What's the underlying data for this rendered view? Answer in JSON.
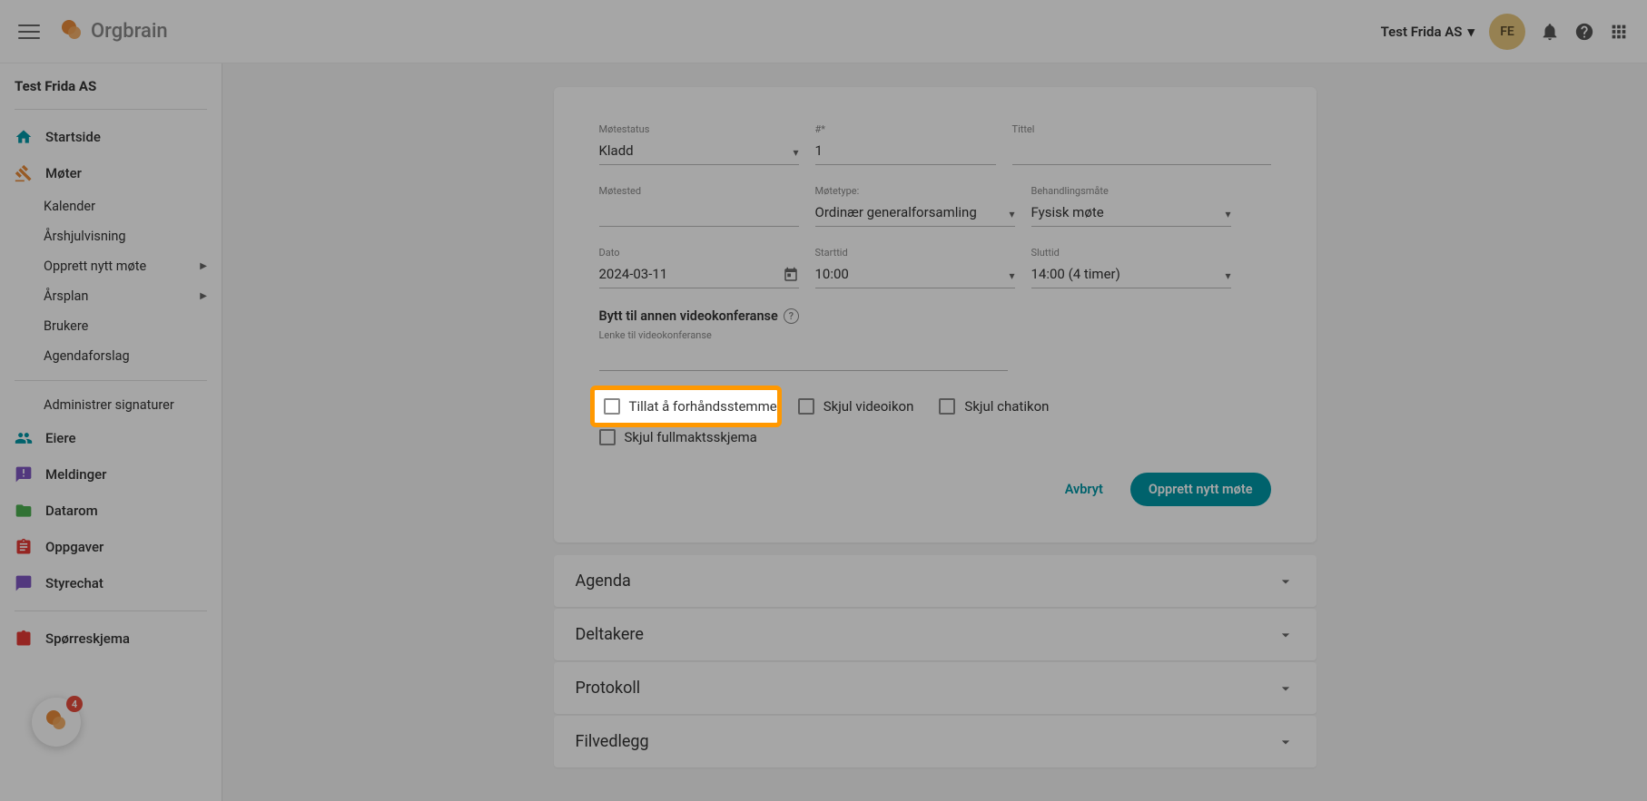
{
  "header": {
    "org_name": "Test Frida AS",
    "avatar_initials": "FE"
  },
  "logo_text": "Orgbrain",
  "sidebar": {
    "title": "Test Frida AS",
    "items": {
      "startside": "Startside",
      "moter": "Møter",
      "kalender": "Kalender",
      "arshjul": "Årshjulvisning",
      "opprett": "Opprett nytt møte",
      "arsplan": "Årsplan",
      "brukere": "Brukere",
      "agenda": "Agendaforslag",
      "signaturer": "Administrer signaturer",
      "eiere": "Eiere",
      "meldinger": "Meldinger",
      "datarom": "Datarom",
      "oppgaver": "Oppgaver",
      "styrechat": "Styrechat",
      "sporreskjema": "Spørreskjema"
    }
  },
  "form": {
    "labels": {
      "motestatus": "Møtestatus",
      "number": "#*",
      "tittel": "Tittel",
      "motested": "Møtested",
      "motetype": "Møtetype:",
      "behandling": "Behandlingsmåte",
      "dato": "Dato",
      "starttid": "Starttid",
      "sluttid": "Sluttid",
      "lenke_video": "Lenke til videokonferanse"
    },
    "values": {
      "motestatus": "Kladd",
      "number": "1",
      "tittel": "",
      "motested": "",
      "motetype": "Ordinær generalforsamling",
      "behandling": "Fysisk møte",
      "dato": "2024-03-11",
      "starttid": "10:00",
      "sluttid": "14:00 (4 timer)"
    },
    "video_link_text": "Bytt til annen videokonferanse",
    "checkboxes": {
      "forhands": "Tillat å forhåndsstemme",
      "videoikon": "Skjul videoikon",
      "chatikon": "Skjul chatikon",
      "fullmakt": "Skjul fullmaktsskjema"
    },
    "buttons": {
      "cancel": "Avbryt",
      "create": "Opprett nytt møte"
    }
  },
  "panels": {
    "agenda": "Agenda",
    "deltakere": "Deltakere",
    "protokoll": "Protokoll",
    "filvedlegg": "Filvedlegg"
  },
  "chat_badge": "4"
}
